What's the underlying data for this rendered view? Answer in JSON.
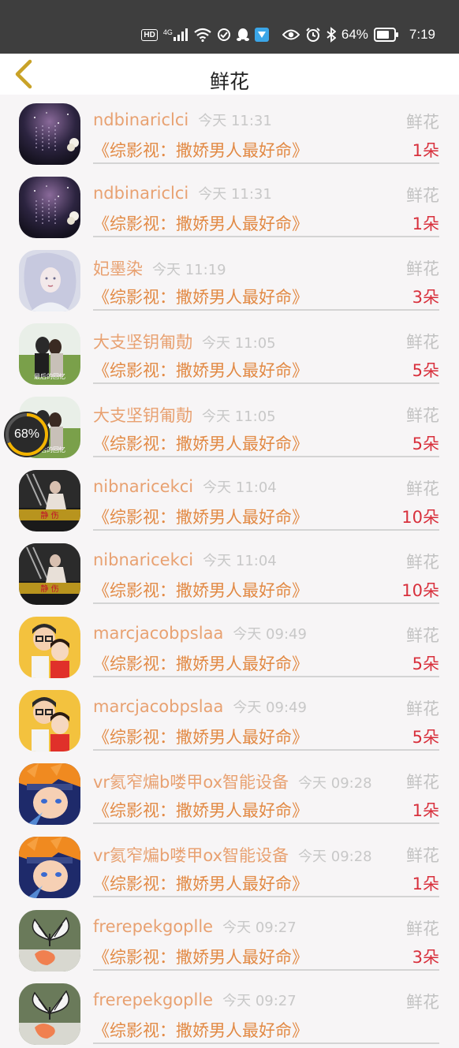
{
  "status_bar": {
    "hd": "HD",
    "network": "4G",
    "battery_percent": "64%",
    "time": "7:19"
  },
  "nav": {
    "title": "鲜花",
    "back_icon": "chevron-left-icon"
  },
  "overlay_badge": {
    "text": "68%",
    "progress": 0.68
  },
  "rows": [
    {
      "name": "ndbinariclci",
      "time": "今天 11:31",
      "type": "鲜花",
      "book": "《综影视：撒娇男人最好命》",
      "count": "1朵",
      "avatar": "galaxy"
    },
    {
      "name": "ndbinariclci",
      "time": "今天 11:31",
      "type": "鲜花",
      "book": "《综影视：撒娇男人最好命》",
      "count": "1朵",
      "avatar": "galaxy"
    },
    {
      "name": "妃墨染",
      "time": "今天 11:19",
      "type": "鲜花",
      "book": "《综影视：撒娇男人最好命》",
      "count": "3朵",
      "avatar": "fairy"
    },
    {
      "name": "大支坚钥匍勣",
      "time": "今天 11:05",
      "type": "鲜花",
      "book": "《综影视：撒娇男人最好命》",
      "count": "5朵",
      "avatar": "couple",
      "avatar_caption": "最后的回忆"
    },
    {
      "name": "大支坚钥匍勣",
      "time": "今天 11:05",
      "type": "鲜花",
      "book": "《综影视：撒娇男人最好命》",
      "count": "5朵",
      "avatar": "couple",
      "avatar_caption": "最后的回忆"
    },
    {
      "name": "nibnaricekci",
      "time": "今天 11:04",
      "type": "鲜花",
      "book": "《综影视：撒娇男人最好命》",
      "count": "10朵",
      "avatar": "dark"
    },
    {
      "name": "nibnaricekci",
      "time": "今天 11:04",
      "type": "鲜花",
      "book": "《综影视：撒娇男人最好命》",
      "count": "10朵",
      "avatar": "dark"
    },
    {
      "name": "marcjacobpslaa",
      "time": "今天 09:49",
      "type": "鲜花",
      "book": "《综影视：撒娇男人最好命》",
      "count": "5朵",
      "avatar": "cartoon"
    },
    {
      "name": "marcjacobpslaa",
      "time": "今天 09:49",
      "type": "鲜花",
      "book": "《综影视：撒娇男人最好命》",
      "count": "5朵",
      "avatar": "cartoon"
    },
    {
      "name": "vr氦窄煸b喽甲ox智能设备",
      "time": "今天 09:28",
      "type": "鲜花",
      "book": "《综影视：撒娇男人最好命》",
      "count": "1朵",
      "avatar": "anime"
    },
    {
      "name": "vr氦窄煸b喽甲ox智能设备",
      "time": "今天 09:28",
      "type": "鲜花",
      "book": "《综影视：撒娇男人最好命》",
      "count": "1朵",
      "avatar": "anime"
    },
    {
      "name": "frerepekgoplle",
      "time": "今天 09:27",
      "type": "鲜花",
      "book": "《综影视：撒娇男人最好命》",
      "count": "3朵",
      "avatar": "butterfly"
    },
    {
      "name": "frerepekgoplle",
      "time": "今天 09:27",
      "type": "鲜花",
      "book": "《综影视：撒娇男人最好命》",
      "count": "",
      "avatar": "butterfly"
    }
  ]
}
